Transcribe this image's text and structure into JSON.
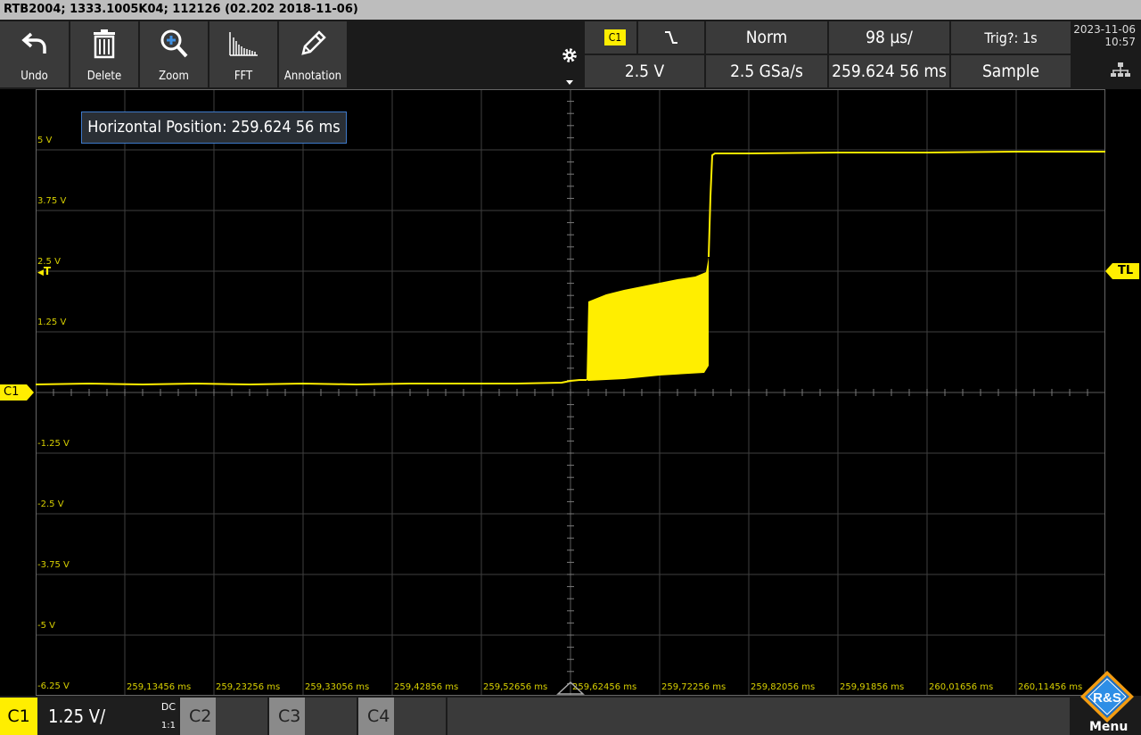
{
  "title_bar": "RTB2004; 1333.1005K04; 112126 (02.202 2018-11-06)",
  "toolbar": {
    "undo": "Undo",
    "delete": "Delete",
    "zoom": "Zoom",
    "fft": "FFT",
    "annotation": "Annotation"
  },
  "status": {
    "trigger_source": "C1",
    "trigger_slope": "falling",
    "trigger_mode": "Norm",
    "timebase": "98 µs/",
    "trig_status": "Trig?: 1s",
    "trigger_level": "2.5 V",
    "sample_rate": "2.5 GSa/s",
    "horizontal_position": "259.624 56 ms",
    "acquisition": "Sample",
    "date": "2023-11-06",
    "time": "10:57"
  },
  "tooltip": "Horizontal Position: 259.624 56 ms",
  "markers": {
    "trigger_marker": "T",
    "trigger_level_marker": "TL",
    "channel_marker": "C1"
  },
  "y_axis_labels": [
    "5 V",
    "3.75 V",
    "2.5 V",
    "1.25 V",
    "-1.25 V",
    "-2.5 V",
    "-3.75 V",
    "-5 V",
    "-6.25 V"
  ],
  "x_axis_labels": [
    "259,13456 ms",
    "259,23256 ms",
    "259,33056 ms",
    "259,42856 ms",
    "259,52656 ms",
    "259,62456 ms",
    "259,72256 ms",
    "259,82056 ms",
    "259,91856 ms",
    "260,01656 ms",
    "260,11456 ms"
  ],
  "bottom_bar": {
    "c1_label": "C1",
    "c1_scale": "1.25 V/",
    "c1_coupling": "DC",
    "c1_probe": "1:1",
    "c2_label": "C2",
    "c3_label": "C3",
    "c4_label": "C4",
    "menu_label": "Menu",
    "logo_text": "R&S"
  },
  "colors": {
    "channel1": "#ffee00",
    "panel": "#3a3a3a",
    "background": "#000000",
    "tooltip_border": "#3e79c9"
  }
}
